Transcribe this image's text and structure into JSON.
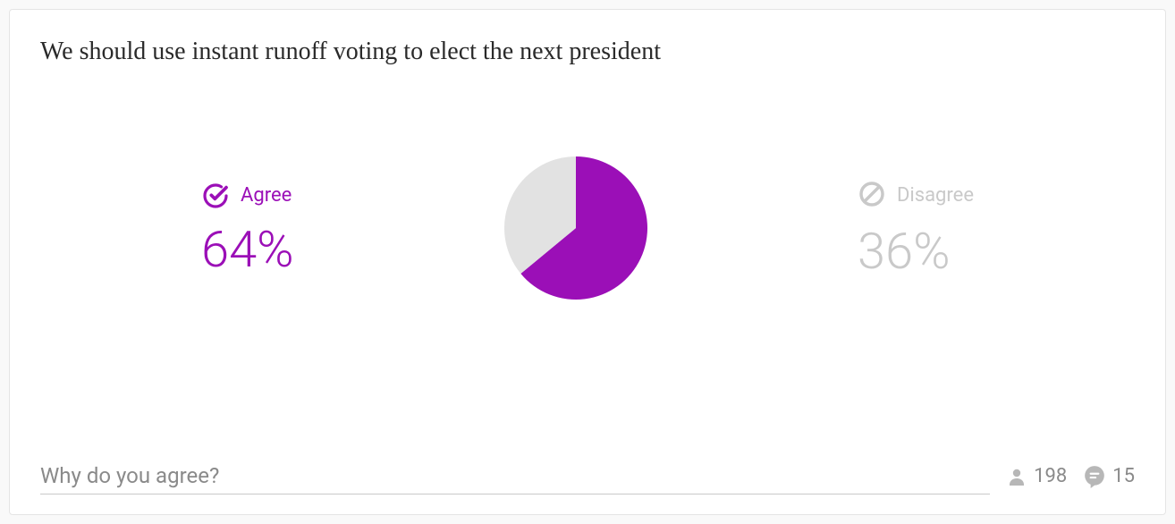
{
  "poll": {
    "title": "We should use instant runoff voting to elect the next president",
    "agree": {
      "label": "Agree",
      "percent": "64%",
      "value": 64
    },
    "disagree": {
      "label": "Disagree",
      "percent": "36%",
      "value": 36
    }
  },
  "colors": {
    "agree": "#9b0fb7",
    "disagree": "#e2e2e2",
    "muted": "#b7b7b7"
  },
  "input": {
    "placeholder": "Why do you agree?"
  },
  "stats": {
    "participants": "198",
    "comments": "15"
  },
  "chart_data": {
    "type": "pie",
    "title": "",
    "series": [
      {
        "name": "Agree",
        "value": 64,
        "color": "#9b0fb7"
      },
      {
        "name": "Disagree",
        "value": 36,
        "color": "#e2e2e2"
      }
    ]
  }
}
